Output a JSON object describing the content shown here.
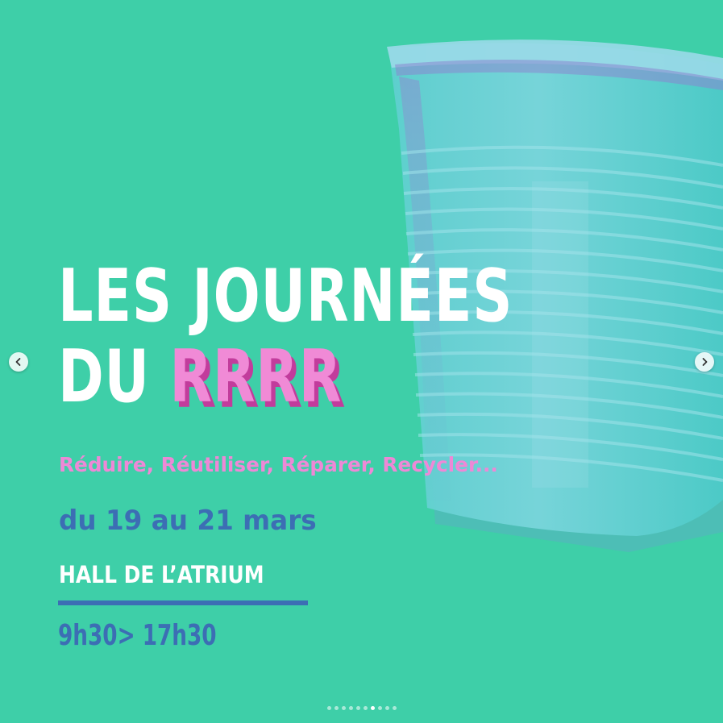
{
  "poster": {
    "title_line1": "LES JOURNÉES",
    "title_line2_prefix": "DU ",
    "title_line2_accent": "RRRR",
    "subtitle": "Réduire, Réutiliser, Réparer, Recycler...",
    "dates": "du 19 au 21 mars",
    "venue": "HALL DE L’ATRIUM",
    "hours": "9h30> 17h30",
    "image_subject": "plastic-cup-icon"
  },
  "carousel": {
    "prev_icon": "chevron-left-icon",
    "next_icon": "chevron-right-icon",
    "slide_count": 10,
    "active_index": 6
  },
  "colors": {
    "background": "#3ecfa8",
    "title": "#ffffff",
    "accent_pink": "#f08ad6",
    "accent_shadow": "#c23c9c",
    "blue": "#3c6eb4"
  }
}
